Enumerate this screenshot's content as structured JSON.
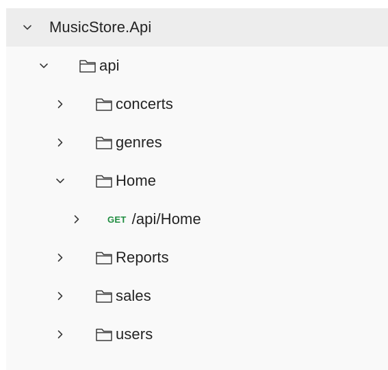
{
  "collection": {
    "name": "MusicStore.Api"
  },
  "folders": {
    "api": "api",
    "concerts": "concerts",
    "genres": "genres",
    "home": "Home",
    "reports": "Reports",
    "sales": "sales",
    "users": "users"
  },
  "requests": {
    "home_get": {
      "method": "GET",
      "path": "/api/Home"
    }
  },
  "colors": {
    "panel_bg": "#f9f9f9",
    "selected_bg": "#ededed",
    "get_method": "#1e8c3f",
    "text": "#232323"
  },
  "icons": {
    "expanded": "chevron-down-icon",
    "collapsed": "chevron-right-icon",
    "folder": "folder-icon"
  }
}
